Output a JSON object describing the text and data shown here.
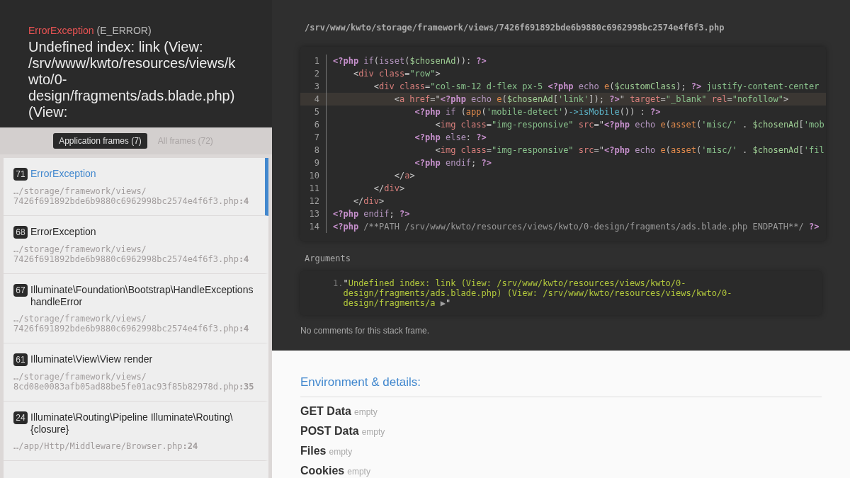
{
  "exception": {
    "class": "ErrorException",
    "code": "(E_ERROR)",
    "message": "Undefined index: link (View: /srv/www/kwto/resources/views/kwto/0-design/fragments/ads.blade.php) (View:"
  },
  "frame_tabs": [
    {
      "label": "Application frames (7)",
      "selected": true
    },
    {
      "label": "All frames (72)",
      "selected": false
    }
  ],
  "frames": [
    {
      "index": "71",
      "title": "ErrorException",
      "file": "…/storage/framework/views/7426f691892bde6b9880c6962998bc2574e4f6f3.php",
      "line": ":4",
      "selected": true
    },
    {
      "index": "68",
      "title": "ErrorException",
      "file": "…/storage/framework/views/7426f691892bde6b9880c6962998bc2574e4f6f3.php",
      "line": ":4",
      "selected": false
    },
    {
      "index": "67",
      "title": "Illuminate\\Foundation\\Bootstrap\\HandleExceptions handleError",
      "file": "…/storage/framework/views/7426f691892bde6b9880c6962998bc2574e4f6f3.php",
      "line": ":4",
      "selected": false
    },
    {
      "index": "61",
      "title": "Illuminate\\View\\View render",
      "file": "…/storage/framework/views/8cd08e0083afb05ad88be5fe01ac93f85b82978d.php",
      "line": ":35",
      "selected": false
    },
    {
      "index": "24",
      "title": "Illuminate\\Routing\\Pipeline Illuminate\\Routing\\{closure}",
      "file": "…/app/Http/Middleware/Browser.php",
      "line": ":24",
      "selected": false
    }
  ],
  "code_view": {
    "file_path": "/srv/www/kwto/storage/framework/views/7426f691892bde6b9880c6962998bc2574e4f6f3.php",
    "lines": [
      {
        "number": "1",
        "highlighted": false,
        "tokens": [
          {
            "kind": "php",
            "text": "<?php "
          },
          {
            "kind": "keyword",
            "text": "if"
          },
          {
            "kind": "plain",
            "text": "("
          },
          {
            "kind": "keyword",
            "text": "isset"
          },
          {
            "kind": "plain",
            "text": "("
          },
          {
            "kind": "variable",
            "text": "$chosenAd"
          },
          {
            "kind": "plain",
            "text": ")): "
          },
          {
            "kind": "php",
            "text": "?>"
          }
        ]
      },
      {
        "number": "2",
        "highlighted": false,
        "tokens": [
          {
            "kind": "plain",
            "text": "    <"
          },
          {
            "kind": "tag",
            "text": "div class"
          },
          {
            "kind": "plain",
            "text": "="
          },
          {
            "kind": "string",
            "text": "\"row\""
          },
          {
            "kind": "plain",
            "text": ">"
          }
        ]
      },
      {
        "number": "3",
        "highlighted": false,
        "tokens": [
          {
            "kind": "plain",
            "text": "        <"
          },
          {
            "kind": "tag",
            "text": "div class"
          },
          {
            "kind": "plain",
            "text": "="
          },
          {
            "kind": "string",
            "text": "\"col-sm-12 d-flex px-5 "
          },
          {
            "kind": "php",
            "text": "<?php "
          },
          {
            "kind": "keyword",
            "text": "echo "
          },
          {
            "kind": "function",
            "text": "e"
          },
          {
            "kind": "plain",
            "text": "("
          },
          {
            "kind": "variable",
            "text": "$customClass"
          },
          {
            "kind": "plain",
            "text": "); "
          },
          {
            "kind": "php",
            "text": "?>"
          },
          {
            "kind": "string",
            "text": " justify-content-center"
          }
        ]
      },
      {
        "number": "4",
        "highlighted": true,
        "tokens": [
          {
            "kind": "plain",
            "text": "            <"
          },
          {
            "kind": "tag",
            "text": "a href"
          },
          {
            "kind": "plain",
            "text": "=\""
          },
          {
            "kind": "php",
            "text": "<?php "
          },
          {
            "kind": "keyword",
            "text": "echo "
          },
          {
            "kind": "function",
            "text": "e"
          },
          {
            "kind": "plain",
            "text": "("
          },
          {
            "kind": "variable",
            "text": "$chosenAd"
          },
          {
            "kind": "plain",
            "text": "["
          },
          {
            "kind": "string",
            "text": "'link'"
          },
          {
            "kind": "plain",
            "text": "]); "
          },
          {
            "kind": "php",
            "text": "?>"
          },
          {
            "kind": "plain",
            "text": "\" "
          },
          {
            "kind": "tag",
            "text": "target"
          },
          {
            "kind": "plain",
            "text": "="
          },
          {
            "kind": "string",
            "text": "\"_blank\" "
          },
          {
            "kind": "tag",
            "text": "rel"
          },
          {
            "kind": "plain",
            "text": "="
          },
          {
            "kind": "string",
            "text": "\"nofollow\""
          },
          {
            "kind": "plain",
            "text": ">"
          }
        ]
      },
      {
        "number": "5",
        "highlighted": false,
        "tokens": [
          {
            "kind": "php",
            "text": "                <?php "
          },
          {
            "kind": "keyword",
            "text": "if"
          },
          {
            "kind": "plain",
            "text": " ("
          },
          {
            "kind": "function",
            "text": "app"
          },
          {
            "kind": "plain",
            "text": "("
          },
          {
            "kind": "string",
            "text": "'mobile-detect'"
          },
          {
            "kind": "plain",
            "text": ")"
          },
          {
            "kind": "method",
            "text": "->isMobile"
          },
          {
            "kind": "plain",
            "text": "()) : "
          },
          {
            "kind": "php",
            "text": "?>"
          }
        ]
      },
      {
        "number": "6",
        "highlighted": false,
        "tokens": [
          {
            "kind": "plain",
            "text": "                    <"
          },
          {
            "kind": "tag",
            "text": "img class"
          },
          {
            "kind": "plain",
            "text": "="
          },
          {
            "kind": "string",
            "text": "\"img-responsive\" "
          },
          {
            "kind": "tag",
            "text": "src"
          },
          {
            "kind": "plain",
            "text": "=\""
          },
          {
            "kind": "php",
            "text": "<?php "
          },
          {
            "kind": "keyword",
            "text": "echo "
          },
          {
            "kind": "function",
            "text": "e"
          },
          {
            "kind": "plain",
            "text": "("
          },
          {
            "kind": "function",
            "text": "asset"
          },
          {
            "kind": "plain",
            "text": "("
          },
          {
            "kind": "string",
            "text": "'misc/'"
          },
          {
            "kind": "plain",
            "text": " . "
          },
          {
            "kind": "variable",
            "text": "$chosenAd"
          },
          {
            "kind": "plain",
            "text": "["
          },
          {
            "kind": "string",
            "text": "'mob"
          }
        ]
      },
      {
        "number": "7",
        "highlighted": false,
        "tokens": [
          {
            "kind": "php",
            "text": "                <?php "
          },
          {
            "kind": "keyword",
            "text": "else"
          },
          {
            "kind": "plain",
            "text": ": "
          },
          {
            "kind": "php",
            "text": "?>"
          }
        ]
      },
      {
        "number": "8",
        "highlighted": false,
        "tokens": [
          {
            "kind": "plain",
            "text": "                    <"
          },
          {
            "kind": "tag",
            "text": "img class"
          },
          {
            "kind": "plain",
            "text": "="
          },
          {
            "kind": "string",
            "text": "\"img-responsive\" "
          },
          {
            "kind": "tag",
            "text": "src"
          },
          {
            "kind": "plain",
            "text": "=\""
          },
          {
            "kind": "php",
            "text": "<?php "
          },
          {
            "kind": "keyword",
            "text": "echo "
          },
          {
            "kind": "function",
            "text": "e"
          },
          {
            "kind": "plain",
            "text": "("
          },
          {
            "kind": "function",
            "text": "asset"
          },
          {
            "kind": "plain",
            "text": "("
          },
          {
            "kind": "string",
            "text": "'misc/'"
          },
          {
            "kind": "plain",
            "text": " . "
          },
          {
            "kind": "variable",
            "text": "$chosenAd"
          },
          {
            "kind": "plain",
            "text": "["
          },
          {
            "kind": "string",
            "text": "'fil"
          }
        ]
      },
      {
        "number": "9",
        "highlighted": false,
        "tokens": [
          {
            "kind": "php",
            "text": "                <?php "
          },
          {
            "kind": "keyword",
            "text": "endif"
          },
          {
            "kind": "plain",
            "text": "; "
          },
          {
            "kind": "php",
            "text": "?>"
          }
        ]
      },
      {
        "number": "10",
        "highlighted": false,
        "tokens": [
          {
            "kind": "plain",
            "text": "            </"
          },
          {
            "kind": "tag",
            "text": "a"
          },
          {
            "kind": "plain",
            "text": ">"
          }
        ]
      },
      {
        "number": "11",
        "highlighted": false,
        "tokens": [
          {
            "kind": "plain",
            "text": "        </"
          },
          {
            "kind": "tag",
            "text": "div"
          },
          {
            "kind": "plain",
            "text": ">"
          }
        ]
      },
      {
        "number": "12",
        "highlighted": false,
        "tokens": [
          {
            "kind": "plain",
            "text": "    </"
          },
          {
            "kind": "tag",
            "text": "div"
          },
          {
            "kind": "plain",
            "text": ">"
          }
        ]
      },
      {
        "number": "13",
        "highlighted": false,
        "tokens": [
          {
            "kind": "php",
            "text": "<?php "
          },
          {
            "kind": "keyword",
            "text": "endif"
          },
          {
            "kind": "plain",
            "text": "; "
          },
          {
            "kind": "php",
            "text": "?>"
          }
        ]
      },
      {
        "number": "14",
        "highlighted": false,
        "tokens": [
          {
            "kind": "php",
            "text": "<?php "
          },
          {
            "kind": "comment",
            "text": "/**PATH /srv/www/kwto/resources/views/kwto/0-design/fragments/ads.blade.php ENDPATH**/ "
          },
          {
            "kind": "php",
            "text": "?>"
          }
        ]
      }
    ]
  },
  "arguments": {
    "label": "Arguments",
    "items": [
      {
        "number": "1.",
        "parts": [
          {
            "kind": "quote",
            "text": "\""
          },
          {
            "kind": "string",
            "text": "Undefined index: link (View: /srv/www/kwto/resources/views/kwto/0-design/fragments/ads.blade.php) (View: /srv/www/kwto/resources/views/kwto/0-design/fragments/a "
          },
          {
            "kind": "toggle",
            "text": "▶"
          },
          {
            "kind": "quote",
            "text": "\""
          }
        ]
      }
    ]
  },
  "comments_note": "No comments for this stack frame.",
  "environment": {
    "heading": "Environment & details:",
    "tables": [
      {
        "title": "GET Data",
        "status": "empty"
      },
      {
        "title": "POST Data",
        "status": "empty"
      },
      {
        "title": "Files",
        "status": "empty"
      },
      {
        "title": "Cookies",
        "status": "empty"
      }
    ]
  }
}
